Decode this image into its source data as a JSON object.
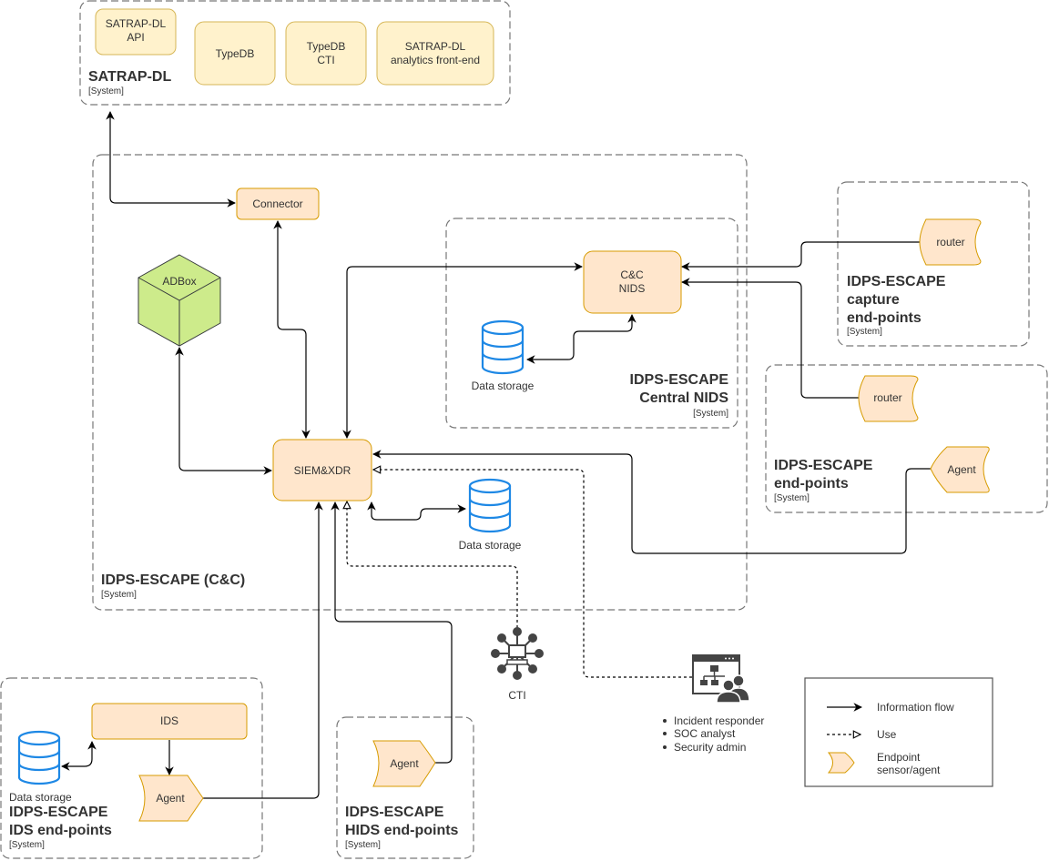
{
  "diagram": {
    "systems": {
      "satrap": {
        "title": "SATRAP-DL",
        "subtitle": "[System]"
      },
      "cc": {
        "title": "IDPS-ESCAPE (C&C)",
        "subtitle": "[System]"
      },
      "central_nids": {
        "title_line1": "IDPS-ESCAPE",
        "title_line2": "Central NIDS",
        "subtitle": "[System]"
      },
      "capture": {
        "title_line1": "IDPS-ESCAPE",
        "title_line2": "capture",
        "title_line3": "end-points",
        "subtitle": "[System]"
      },
      "endpoints": {
        "title_line1": "IDPS-ESCAPE",
        "title_line2": "end-points",
        "subtitle": "[System]"
      },
      "ids_endpoints": {
        "title_line1": "IDPS-ESCAPE",
        "title_line2": "IDS end-points",
        "subtitle": "[System]"
      },
      "hids_endpoints": {
        "title_line1": "IDPS-ESCAPE",
        "title_line2": "HIDS end-points",
        "subtitle": "[System]"
      }
    },
    "nodes": {
      "satrap_api": {
        "line1": "SATRAP-DL",
        "line2": "API"
      },
      "typedb": {
        "line1": "TypeDB"
      },
      "typedb_cti": {
        "line1": "TypeDB",
        "line2": "CTI"
      },
      "satrap_frontend": {
        "line1": "SATRAP-DL",
        "line2": "analytics front-end"
      },
      "connector": {
        "label": "Connector"
      },
      "adbox": {
        "label": "ADBox"
      },
      "siem_xdr": {
        "label": "SIEM&XDR"
      },
      "cc_nids": {
        "line1": "C&C",
        "line2": "NIDS"
      },
      "nids_storage": {
        "label": "Data storage"
      },
      "siem_storage": {
        "label": "Data storage"
      },
      "ids_storage": {
        "label": "Data storage"
      },
      "ids": {
        "label": "IDS"
      },
      "router_capture": {
        "label": "router"
      },
      "router_endpoints": {
        "label": "router"
      },
      "agent_endpoints": {
        "label": "Agent"
      },
      "agent_ids": {
        "label": "Agent"
      },
      "agent_hids": {
        "label": "Agent"
      },
      "cti": {
        "label": "CTI"
      }
    },
    "actors": {
      "roles": [
        "Incident responder",
        "SOC analyst",
        "Security admin"
      ]
    },
    "legend": {
      "items": [
        {
          "label": "Information flow"
        },
        {
          "label": "Use"
        },
        {
          "label_line1": "Endpoint",
          "label_line2": "sensor/agent"
        }
      ]
    },
    "colors": {
      "boundary": "#777777",
      "satrap_fill": "#fff2cc",
      "satrap_stroke": "#d6b656",
      "component_fill": "#ffe6cc",
      "component_stroke": "#d79b00",
      "adbox_fill": "#cdeb8b",
      "database": "#1e88e5",
      "icon_gray": "#444444"
    }
  }
}
